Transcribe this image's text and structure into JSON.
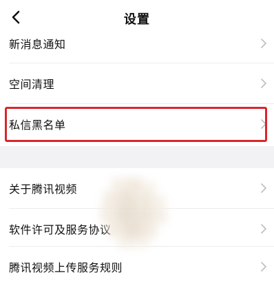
{
  "header": {
    "title": "设置",
    "back_icon": "chevron-left-icon"
  },
  "settings": {
    "new_message_notification": "新消息通知",
    "storage_cleanup": "空间清理",
    "private_message_blacklist": "私信黑名单",
    "about_tencent_video": "关于腾讯视频",
    "software_license_agreement": "软件许可及服务协议",
    "upload_service_rules": "腾讯视频上传服务规则"
  },
  "colors": {
    "highlight_border": "#d8262b",
    "section_gap": "#f2f2f4",
    "chevron": "#bdbdbd"
  }
}
